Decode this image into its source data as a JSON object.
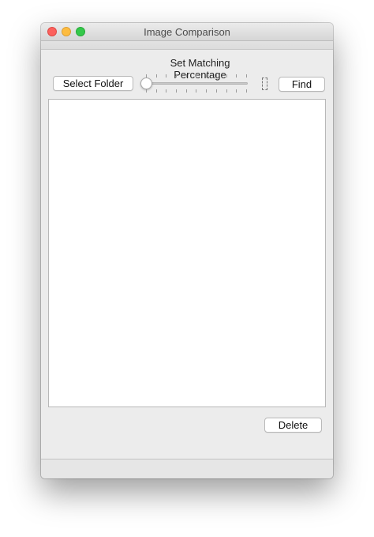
{
  "window": {
    "title": "Image Comparison"
  },
  "controls": {
    "heading": "Set Matching Percentage",
    "select_folder_label": "Select Folder",
    "find_label": "Find",
    "delete_label": "Delete",
    "slider_value_fraction": 0.0,
    "slider_tick_count": 11,
    "value_display": ""
  },
  "colors": {
    "close": "#fc615d",
    "minimize": "#fdbc40",
    "zoom": "#34c84a",
    "slider_fill": "#3b8ff5"
  },
  "results": {
    "items": []
  }
}
